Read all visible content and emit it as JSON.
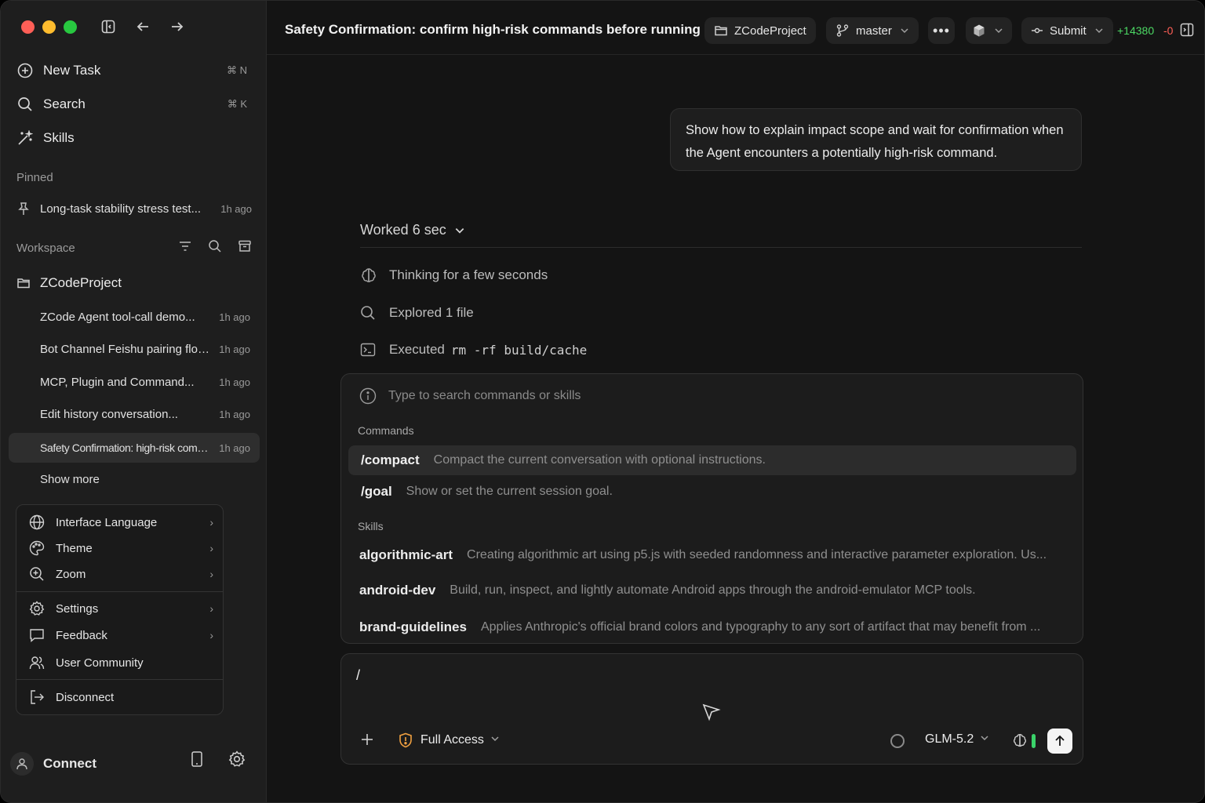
{
  "sidebar": {
    "nav": [
      {
        "label": "New Task",
        "shortcut": "⌘ N",
        "icon": "plus-circle-icon"
      },
      {
        "label": "Search",
        "shortcut": "⌘ K",
        "icon": "search-icon"
      },
      {
        "label": "Skills",
        "shortcut": "",
        "icon": "magic-wand-icon"
      }
    ],
    "pinned_title": "Pinned",
    "pinned": [
      {
        "label": "Long-task stability stress test...",
        "time": "1h ago"
      }
    ],
    "workspace_title": "Workspace",
    "project": "ZCodeProject",
    "tasks": [
      {
        "label": "ZCode Agent tool-call demo...",
        "time": "1h ago"
      },
      {
        "label": "Bot Channel Feishu pairing flow...",
        "time": "1h ago"
      },
      {
        "label": "MCP,  Plugin and Command...",
        "time": "1h ago"
      },
      {
        "label": "Edit history conversation...",
        "time": "1h ago"
      },
      {
        "label": "Safety Confirmation: high-risk command...",
        "time": "1h ago",
        "active": true
      }
    ],
    "show_more": "Show more",
    "menu": {
      "group1": [
        {
          "label": "Interface Language"
        },
        {
          "label": "Theme"
        },
        {
          "label": "Zoom"
        }
      ],
      "group2": [
        {
          "label": "Settings"
        },
        {
          "label": "Feedback"
        },
        {
          "label": "User Community"
        }
      ],
      "disconnect": "Disconnect"
    },
    "connect_label": "Connect"
  },
  "header": {
    "title": "Safety Confirmation: confirm high-risk commands before running",
    "project": "ZCodeProject",
    "branch": "master",
    "submit": "Submit",
    "additions": "+14380",
    "deletions": "-0"
  },
  "conversation": {
    "user_message": "Show how to explain impact scope and wait for confirmation when the Agent encounters a potentially high-risk command.",
    "worked": "Worked 6 sec",
    "steps": {
      "thinking": "Thinking for a few seconds",
      "explored": "Explored 1 file",
      "executed_label": "Executed",
      "executed_cmd": "rm -rf build/cache"
    }
  },
  "palette": {
    "placeholder": "Type to search commands or skills",
    "commands_title": "Commands",
    "commands": [
      {
        "name": "/compact",
        "desc": "Compact the current conversation with optional instructions."
      },
      {
        "name": "/goal",
        "desc": "Show or set the current session goal."
      }
    ],
    "skills_title": "Skills",
    "skills": [
      {
        "name": "algorithmic-art",
        "desc": "Creating algorithmic art using p5.js with seeded randomness and interactive parameter exploration. Us..."
      },
      {
        "name": "android-dev",
        "desc": "Build, run, inspect, and lightly automate Android apps through the android-emulator MCP tools."
      },
      {
        "name": "brand-guidelines",
        "desc": "Applies Anthropic's official brand colors and typography to any sort of artifact that may benefit from ..."
      }
    ]
  },
  "composer": {
    "text": "/",
    "access": "Full Access",
    "model": "GLM-5.2"
  },
  "colors": {
    "accent_green": "#3ad36a",
    "additions": "#4cd964",
    "deletions": "#ff5f57",
    "access_warning": "#f0a040"
  }
}
